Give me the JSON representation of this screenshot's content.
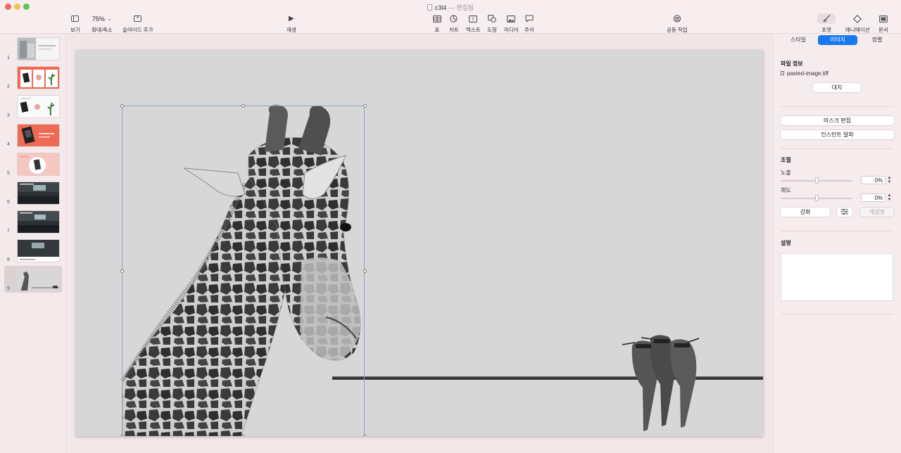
{
  "window": {
    "title": "c3l4",
    "title_separator": "—",
    "title_status": "편집됨"
  },
  "toolbar": {
    "view_label": "보기",
    "zoom_value": "75%",
    "zoom_label": "확대/축소",
    "add_slide_label": "슬라이드 추가",
    "play_label": "재생",
    "table_label": "표",
    "chart_label": "차트",
    "text_label": "텍스트",
    "shape_label": "도형",
    "media_label": "미디어",
    "comment_label": "주석",
    "collaborate_label": "공동 작업",
    "format_label": "포맷",
    "animate_label": "애니메이션",
    "document_label": "문서"
  },
  "navigator": {
    "slides": [
      {
        "number": "1"
      },
      {
        "number": "2"
      },
      {
        "number": "3"
      },
      {
        "number": "4"
      },
      {
        "number": "5"
      },
      {
        "number": "6"
      },
      {
        "number": "7"
      },
      {
        "number": "8"
      },
      {
        "number": "9"
      }
    ],
    "selected_index": 8
  },
  "inspector": {
    "tabs": [
      "스타일",
      "이미지",
      "정렬"
    ],
    "active_tab": "이미지",
    "file_info_title": "파일 정보",
    "file_name": "pasted-image.tiff",
    "replace_label": "대치",
    "edit_mask_label": "마스크 편집",
    "instant_alpha_label": "인스턴트 알파",
    "adjust_title": "조절",
    "exposure_label": "노출",
    "exposure_value": "0%",
    "saturation_label": "채도",
    "saturation_value": "0%",
    "enhance_label": "강화",
    "reset_label": "재설정",
    "description_title": "설명"
  },
  "colors": {
    "accent": "#1778f2",
    "slide_background": "#d7d7d7",
    "thumb_coral": "#ee6a53",
    "thumb_pink": "#f6c6c0"
  },
  "icons": {
    "view": "sidebar-icon",
    "add_slide": "plus-box-icon",
    "play": "play-icon",
    "table": "table-icon",
    "chart": "chart-icon",
    "text": "text-box-icon",
    "shape": "shape-icon",
    "media": "image-icon",
    "comment": "comment-icon",
    "collaborate": "collaborate-icon",
    "format": "paintbrush-icon",
    "animate": "diamond-icon",
    "document": "document-icon"
  }
}
